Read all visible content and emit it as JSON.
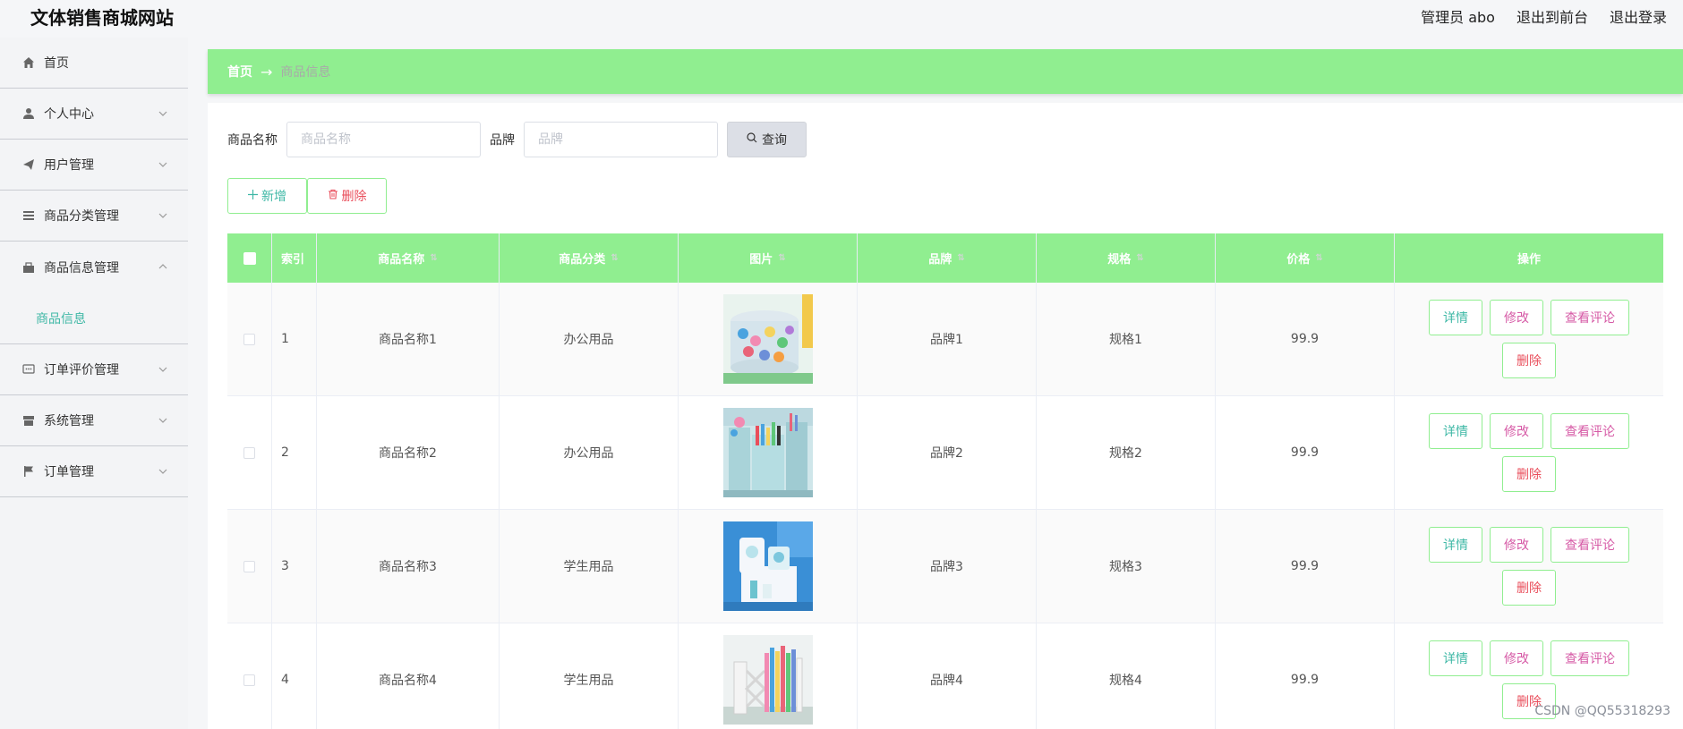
{
  "header": {
    "title": "文体销售商城网站",
    "admin_label": "管理员 abo",
    "to_front": "退出到前台",
    "logout": "退出登录"
  },
  "sidebar": {
    "items": [
      {
        "label": "首页",
        "icon": "home-icon"
      },
      {
        "label": "个人中心",
        "icon": "user-icon"
      },
      {
        "label": "用户管理",
        "icon": "send-icon"
      },
      {
        "label": "商品分类管理",
        "icon": "list-icon"
      },
      {
        "label": "商品信息管理",
        "icon": "cart-icon"
      },
      {
        "label": "订单评价管理",
        "icon": "chat-icon"
      },
      {
        "label": "系统管理",
        "icon": "shop-icon"
      },
      {
        "label": "订单管理",
        "icon": "flag-icon"
      }
    ],
    "sub_item": "商品信息"
  },
  "breadcrumb": {
    "home": "首页",
    "arrow": "→",
    "current": "商品信息"
  },
  "search": {
    "name_label": "商品名称",
    "name_placeholder": "商品名称",
    "brand_label": "品牌",
    "brand_placeholder": "品牌",
    "query_button": "查询"
  },
  "actions": {
    "add": "新增",
    "delete": "删除"
  },
  "table": {
    "columns": [
      "索引",
      "商品名称",
      "商品分类",
      "图片",
      "品牌",
      "规格",
      "价格",
      "操作"
    ],
    "rows": [
      {
        "index": "1",
        "name": "商品名称1",
        "category": "办公用品",
        "brand": "品牌1",
        "spec": "规格1",
        "price": "99.9"
      },
      {
        "index": "2",
        "name": "商品名称2",
        "category": "办公用品",
        "brand": "品牌2",
        "spec": "规格2",
        "price": "99.9"
      },
      {
        "index": "3",
        "name": "商品名称3",
        "category": "学生用品",
        "brand": "品牌3",
        "spec": "规格3",
        "price": "99.9"
      },
      {
        "index": "4",
        "name": "商品名称4",
        "category": "学生用品",
        "brand": "品牌4",
        "spec": "规格4",
        "price": "99.9"
      }
    ],
    "op_labels": {
      "detail": "详情",
      "edit": "修改",
      "review": "查看评论",
      "delete": "删除"
    }
  },
  "watermark": "CSDN @QQ55318293",
  "colors": {
    "accent": "#90ee90",
    "teal": "#3fb8a6",
    "pink": "#d65aa6",
    "red": "#e94e5b"
  }
}
